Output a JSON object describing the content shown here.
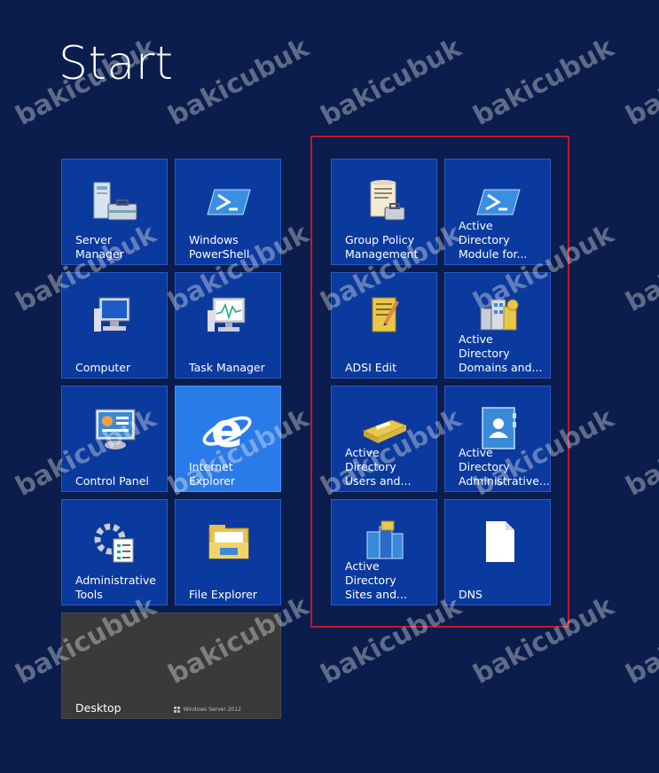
{
  "screen_title": "Start",
  "tiles": [
    {
      "label": "Server Manager",
      "icon": "server-manager-icon"
    },
    {
      "label": "Windows\nPowerShell",
      "icon": "powershell-icon"
    },
    {
      "label": "Computer",
      "icon": "computer-icon"
    },
    {
      "label": "Task Manager",
      "icon": "task-manager-icon"
    },
    {
      "label": "Control Panel",
      "icon": "control-panel-icon"
    },
    {
      "label": "Internet Explorer",
      "icon": "internet-explorer-icon"
    },
    {
      "label": "Administrative\nTools",
      "icon": "administrative-tools-icon"
    },
    {
      "label": "File Explorer",
      "icon": "file-explorer-icon"
    },
    {
      "label": "Desktop",
      "badge": "Windows Server 2012"
    },
    {
      "label": "Group Policy\nManagement",
      "icon": "group-policy-icon"
    },
    {
      "label": "Active Directory\nModule for...",
      "icon": "powershell-icon"
    },
    {
      "label": "ADSI Edit",
      "icon": "adsi-edit-icon"
    },
    {
      "label": "Active Directory\nDomains and...",
      "icon": "ad-domains-icon"
    },
    {
      "label": "Active Directory\nUsers and...",
      "icon": "ad-users-icon"
    },
    {
      "label": "Active Directory\nAdministrative...",
      "icon": "ad-admin-center-icon"
    },
    {
      "label": "Active Directory\nSites and...",
      "icon": "ad-sites-icon"
    },
    {
      "label": "DNS",
      "icon": "dns-document-icon"
    }
  ],
  "watermark": "bakicubuk",
  "colors": {
    "background": "#0a1d4d",
    "tile": "#0b3a9e",
    "ie_tile": "#2a7bea",
    "desktop_tile": "#3a3a3a",
    "highlight": "#c4162a"
  }
}
